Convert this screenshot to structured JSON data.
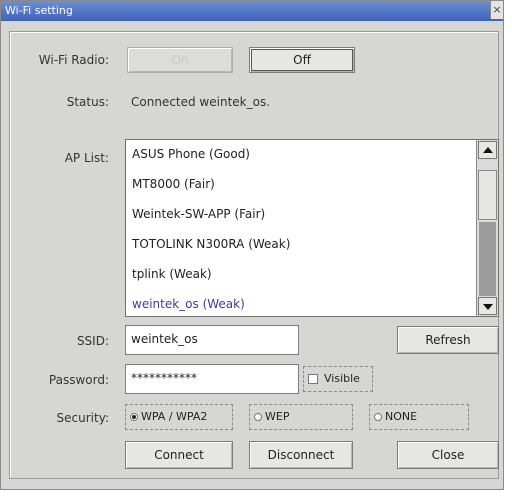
{
  "window": {
    "title": "Wi-Fi setting",
    "close_glyph": "×"
  },
  "radio_row": {
    "label": "Wi-Fi Radio:",
    "on_label": "On",
    "off_label": "Off"
  },
  "status": {
    "label": "Status:",
    "value": "Connected weintek_os."
  },
  "ap_list": {
    "label": "AP List:",
    "items": [
      "ASUS Phone (Good)",
      "MT8000 (Fair)",
      "Weintek-SW-APP (Fair)",
      "TOTOLINK N300RA (Weak)",
      "tplink (Weak)",
      "weintek_os (Weak)"
    ],
    "selected": "weintek_os (Weak)"
  },
  "ssid": {
    "label": "SSID:",
    "value": "weintek_os"
  },
  "refresh_label": "Refresh",
  "password": {
    "label": "Password:",
    "value": "***********",
    "visible_label": "Visible",
    "visible_checked": false
  },
  "security": {
    "label": "Security:",
    "options": [
      "WPA / WPA2",
      "WEP",
      "NONE"
    ],
    "selected": "WPA / WPA2"
  },
  "actions": {
    "connect": "Connect",
    "disconnect": "Disconnect",
    "close": "Close"
  },
  "icons": {
    "scroll_up": "scroll-up-arrow-icon",
    "scroll_down": "scroll-down-arrow-icon"
  },
  "colors": {
    "title_bar": "#4a6fc4",
    "selected_item": "#3c3ca8"
  }
}
